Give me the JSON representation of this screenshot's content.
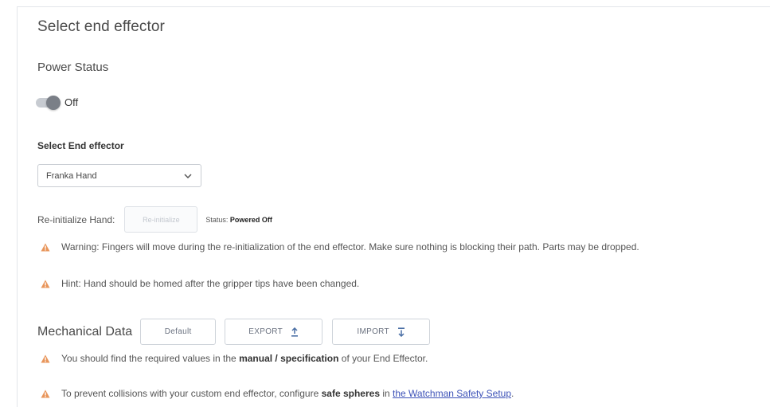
{
  "page": {
    "title": "Select end effector"
  },
  "power": {
    "label": "Power Status",
    "toggle_text": "Off"
  },
  "end_effector": {
    "label": "Select End effector",
    "selected": "Franka Hand"
  },
  "reinit": {
    "label": "Re-initialize Hand:",
    "button": "Re-initialize",
    "status_prefix": "Status:",
    "status_value": "Powered Off"
  },
  "notes": {
    "warning": "Warning: Fingers will move during the re-initialization of the end effector. Make sure nothing is blocking their path. Parts may be dropped.",
    "hint": "Hint: Hand should be homed after the gripper tips have been changed."
  },
  "mechanical": {
    "title": "Mechanical Data",
    "default_button": "Default",
    "export_button": "EXPORT",
    "import_button": "IMPORT"
  },
  "info": {
    "values_prefix": "You should find the required values in the ",
    "values_bold": "manual / specification",
    "values_suffix": " of your End Effector.",
    "collision_prefix": "To prevent collisions with your custom end effector, configure ",
    "collision_bold": "safe spheres",
    "collision_mid": " in ",
    "collision_link": "the Watchman Safety Setup",
    "collision_suffix": "."
  },
  "colors": {
    "warning": "#e8955a",
    "link": "#3d52b8",
    "accent_icon": "#4a6fa5"
  }
}
